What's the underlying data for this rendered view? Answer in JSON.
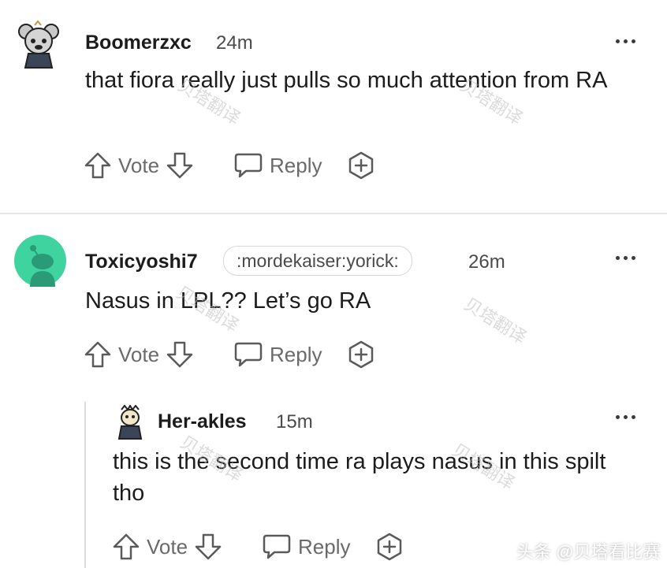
{
  "comments": [
    {
      "username": "Boomerzxc",
      "time": "24m",
      "body": "that fiora really just pulls so much attention from RA",
      "vote_label": "Vote",
      "reply_label": "Reply"
    },
    {
      "username": "Toxicyoshi7",
      "flair": ":mordekaiser:yorick:",
      "time": "26m",
      "body": "Nasus in LPL?? Let’s go RA",
      "vote_label": "Vote",
      "reply_label": "Reply",
      "avatar_color": "#3fd3a0"
    },
    {
      "username": "Her-akles",
      "time": "15m",
      "body": "this is the second time ra plays nasus in this spilt tho",
      "vote_label": "Vote",
      "reply_label": "Reply"
    }
  ],
  "watermarks": {
    "overlay": "贝塔翻译",
    "footer": "头条 @贝塔看比赛"
  },
  "icons": [
    "upvote-icon",
    "downvote-icon",
    "reply-bubble-icon",
    "award-plus-icon",
    "more-options-icon"
  ]
}
